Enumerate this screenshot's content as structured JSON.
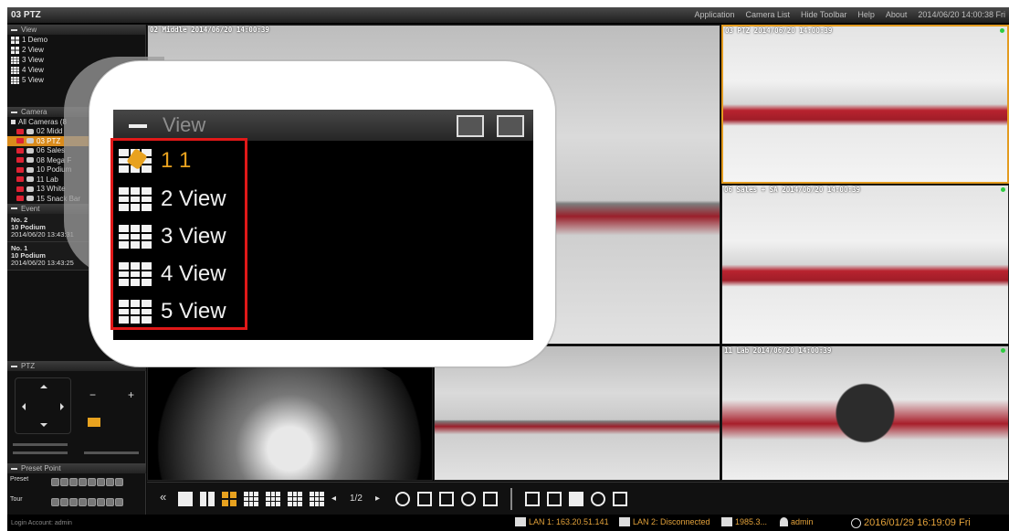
{
  "window": {
    "title": "03 PTZ",
    "menu": [
      "Application",
      "Camera List",
      "Hide Toolbar",
      "Help",
      "About"
    ],
    "datetime": "2014/06/20 14:00:38 Fri"
  },
  "sidebar": {
    "view_section": "View",
    "views": [
      "1 Demo",
      "2 View",
      "3 View",
      "4 View",
      "5 View"
    ],
    "camera_section": "Camera",
    "camera_root": "All Cameras (8",
    "cameras": [
      "02 Midd",
      "03 PTZ",
      "06 Sales",
      "08 Mega F",
      "10 Podium",
      "11 Lab",
      "13 White",
      "15 Snack Bar"
    ],
    "event_section": "Event",
    "events": [
      {
        "no": "No. 2",
        "camera": "10 Podium",
        "time": "2014/06/20 13:43:31"
      },
      {
        "no": "No. 1",
        "camera": "10 Podium",
        "time": "2014/06/20 13:43:25"
      }
    ],
    "ptz_section": "PTZ",
    "preset_section": "Preset Point",
    "preset_label": "Preset",
    "tour_label": "Tour"
  },
  "videos": [
    {
      "label": "02 Middle  2014/06/20 14:00:39"
    },
    {
      "label": "03 PTZ  2014/06/20 14:00:39"
    },
    {
      "label": "06 Sales + SA  2014/06/20 14:00:39"
    },
    {
      "label": "11 Lab  2014/06/20 14:00:39"
    }
  ],
  "toolbar": {
    "prev": "«",
    "page": "1/2"
  },
  "status": {
    "login": "Login Account: admin",
    "lan1": "LAN 1: 163.20.51.141",
    "lan2": "LAN 2: Disconnected",
    "disk": "1985.3...",
    "user": "admin",
    "clock": "2016/01/29 16:19:09 Fri"
  },
  "callout": {
    "title": "View",
    "items": [
      "1 1",
      "2 View",
      "3 View",
      "4 View",
      "5 View"
    ]
  },
  "colors": {
    "accent": "#e8a21f",
    "highlight": "#e01818",
    "status_text": "#e2a13a"
  }
}
